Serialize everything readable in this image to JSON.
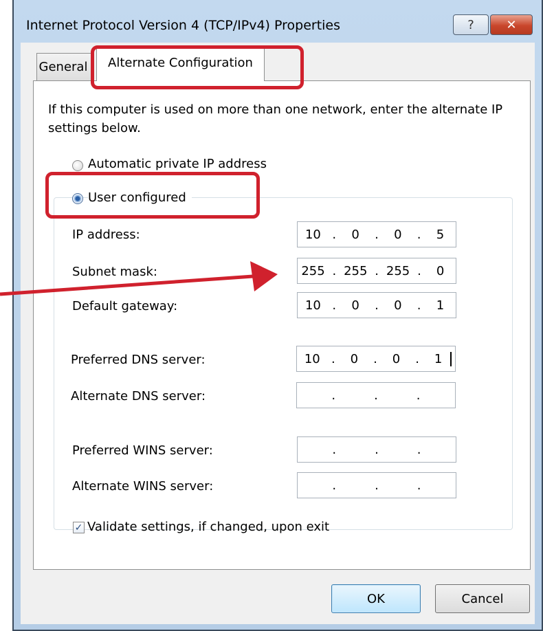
{
  "window": {
    "title": "Internet Protocol Version 4 (TCP/IPv4) Properties",
    "help_glyph": "?",
    "close_glyph": "✕"
  },
  "tabs": [
    {
      "label": "General",
      "selected": false
    },
    {
      "label": "Alternate Configuration",
      "selected": true
    }
  ],
  "intro_text": "If this computer is used on more than one network, enter the alternate IP settings below.",
  "radios": {
    "automatic": {
      "label": "Automatic private IP address",
      "checked": false
    },
    "user": {
      "label": "User configured",
      "checked": true
    }
  },
  "fields": {
    "ip_address": {
      "label": "IP address:",
      "octets": [
        "10",
        "0",
        "0",
        "5"
      ]
    },
    "subnet_mask": {
      "label": "Subnet mask:",
      "octets": [
        "255",
        "255",
        "255",
        "0"
      ]
    },
    "default_gateway": {
      "label": "Default gateway:",
      "octets": [
        "10",
        "0",
        "0",
        "1"
      ]
    },
    "preferred_dns": {
      "label": "Preferred DNS server:",
      "octets": [
        "10",
        "0",
        "0",
        "1"
      ]
    },
    "alternate_dns": {
      "label": "Alternate DNS server:",
      "octets": [
        "",
        "",
        "",
        ""
      ]
    },
    "preferred_wins": {
      "label": "Preferred WINS server:",
      "octets": [
        "",
        "",
        "",
        ""
      ]
    },
    "alternate_wins": {
      "label": "Alternate WINS server:",
      "octets": [
        "",
        "",
        "",
        ""
      ]
    }
  },
  "validate": {
    "label": "Validate settings, if changed, upon exit",
    "checked": true,
    "glyph": "✓"
  },
  "buttons": {
    "ok": "OK",
    "cancel": "Cancel"
  },
  "colors": {
    "highlight": "#d0212d",
    "title_bar": "#c3d9ef",
    "ok_button": "#bee6fd"
  },
  "icons": {
    "help": "help-icon",
    "close": "close-icon",
    "annotation_arrow": "arrow-icon"
  }
}
